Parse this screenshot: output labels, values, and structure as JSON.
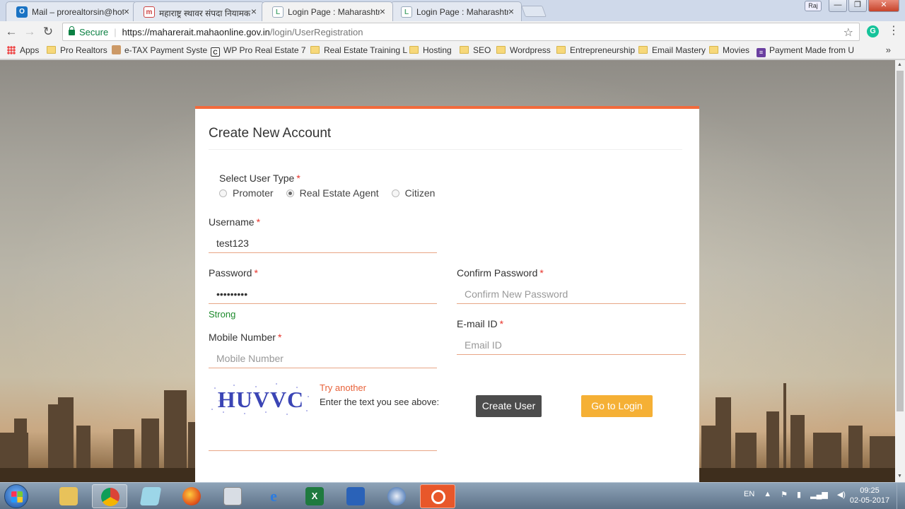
{
  "browser": {
    "tabs": [
      {
        "label": "Mail – prorealtorsin@hotmail",
        "icon": "O"
      },
      {
        "label": "महाराष्ट्र स्थावर संपदा नियामक",
        "icon": "m"
      },
      {
        "label": "Login Page : Maharashtra",
        "icon": "L"
      },
      {
        "label": "Login Page : Maharashtra",
        "icon": "L"
      }
    ],
    "tab_close_glyph": "×",
    "profile_badge": "Raj",
    "window_controls": {
      "minimize": "—",
      "maximize": "❐",
      "close": "✕"
    },
    "nav": {
      "back": "←",
      "forward": "→",
      "reload": "↻"
    },
    "address": {
      "secure_label": "Secure",
      "url_host": "https://maharerait.mahaonline.gov.in",
      "url_path": "/login/UserRegistration"
    },
    "bookmark_star": "☆",
    "extension_letter": "G",
    "menu_glyph": "⋮",
    "bookmarks": [
      {
        "label": "Apps",
        "type": "apps"
      },
      {
        "label": "Pro Realtors",
        "type": "folder"
      },
      {
        "label": "e-TAX Payment Syste",
        "type": "site"
      },
      {
        "label": "WP Pro Real Estate 7",
        "type": "site-c"
      },
      {
        "label": "Real Estate Training L",
        "type": "folder"
      },
      {
        "label": "Hosting",
        "type": "folder"
      },
      {
        "label": "SEO",
        "type": "folder"
      },
      {
        "label": "Wordpress",
        "type": "folder"
      },
      {
        "label": "Entrepreneurship",
        "type": "folder"
      },
      {
        "label": "Email Mastery",
        "type": "folder"
      },
      {
        "label": "Movies",
        "type": "folder"
      },
      {
        "label": "Payment Made from U",
        "type": "site-list"
      }
    ],
    "bookmarks_more": "»"
  },
  "form": {
    "title": "Create New Account",
    "user_type": {
      "label": "Select User Type",
      "required_mark": "*",
      "options": [
        "Promoter",
        "Real Estate Agent",
        "Citizen"
      ],
      "selected": "Real Estate Agent"
    },
    "username": {
      "label": "Username",
      "required_mark": "*",
      "value": "test123",
      "placeholder": ""
    },
    "password": {
      "label": "Password",
      "required_mark": "*",
      "value": "•••••••••",
      "strength": "Strong"
    },
    "confirm_password": {
      "label": "Confirm Password",
      "required_mark": "*",
      "value": "",
      "placeholder": "Confirm New Password"
    },
    "mobile": {
      "label": "Mobile Number",
      "required_mark": "*",
      "value": "",
      "placeholder": "Mobile Number"
    },
    "email": {
      "label": "E-mail ID",
      "required_mark": "*",
      "value": "",
      "placeholder": "Email ID"
    },
    "captcha": {
      "text": "HUVVC",
      "try_another": "Try another",
      "hint": "Enter the text you see above:",
      "value": ""
    },
    "buttons": {
      "create": "Create User",
      "login": "Go to Login"
    }
  },
  "taskbar": {
    "apps": [
      "explorer",
      "chrome",
      "notepad",
      "firefox",
      "calculator",
      "internet-explorer",
      "excel",
      "outlook",
      "thunderbird",
      "recorder"
    ],
    "active": "recorder",
    "tray": {
      "language": "EN",
      "show_hidden": "▲"
    },
    "clock": {
      "time": "09:25",
      "date": "02-05-2017"
    }
  },
  "colors": {
    "accent": "#f26a3c",
    "create_button": "#4c4c4c",
    "login_button": "#f5b035",
    "strong_text": "#1d8a2c",
    "required": "#e8332a"
  }
}
